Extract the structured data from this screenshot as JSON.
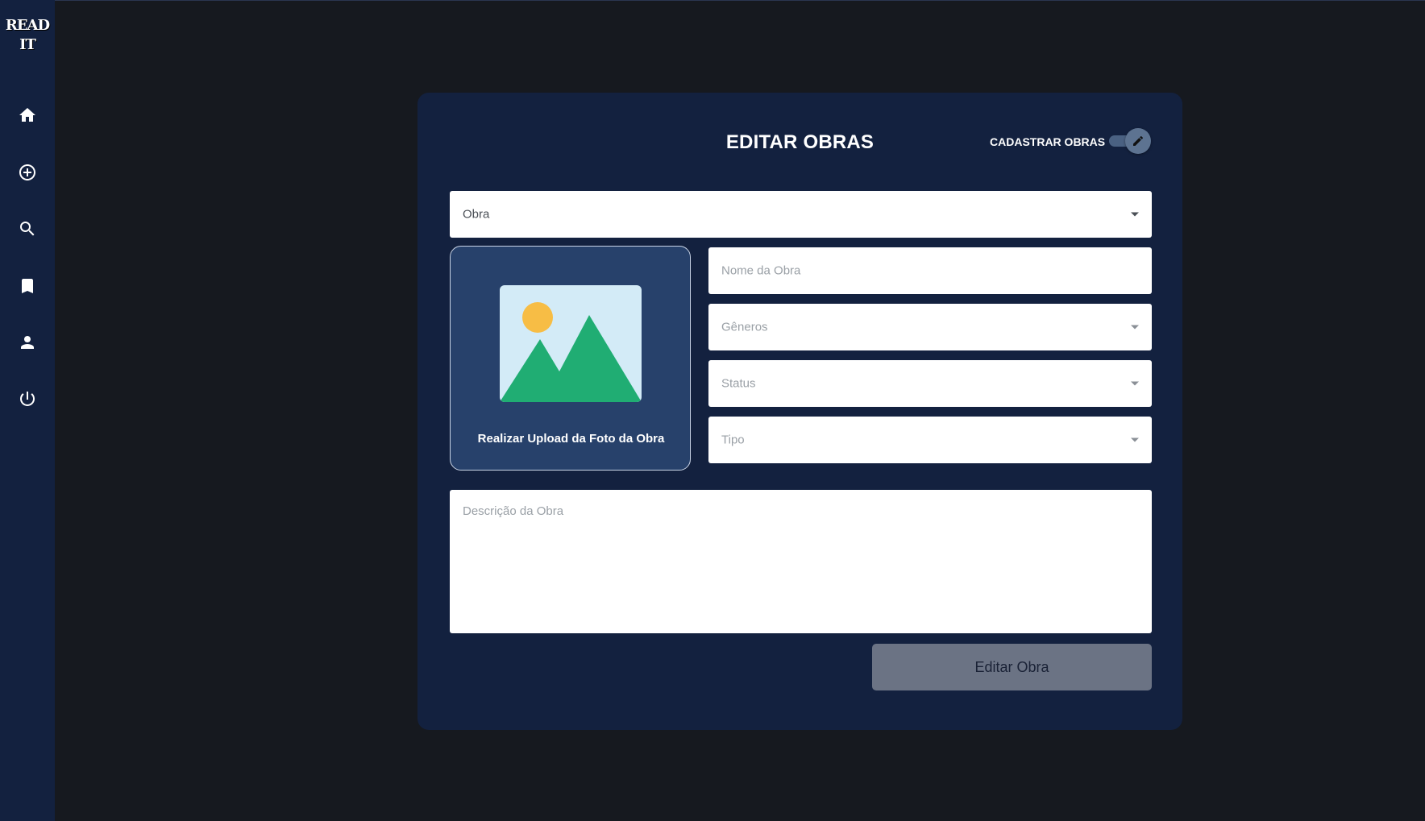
{
  "app": {
    "logo_text": "READ IT"
  },
  "sidebar": {
    "items": [
      {
        "icon": "home-icon"
      },
      {
        "icon": "add-circle-icon"
      },
      {
        "icon": "search-icon"
      },
      {
        "icon": "bookmark-icon"
      },
      {
        "icon": "user-icon"
      },
      {
        "icon": "power-icon"
      }
    ]
  },
  "form": {
    "title": "EDITAR OBRAS",
    "mode_switch": {
      "label": "CADASTRAR OBRAS",
      "icon": "pencil-icon",
      "checked": true
    },
    "obra_select": {
      "value": "Obra"
    },
    "upload": {
      "label": "Realizar Upload da Foto da Obra",
      "icon": "image-placeholder-icon"
    },
    "nome": {
      "placeholder": "Nome da Obra"
    },
    "generos": {
      "placeholder": "Gêneros"
    },
    "status": {
      "placeholder": "Status"
    },
    "tipo": {
      "placeholder": "Tipo"
    },
    "descricao": {
      "placeholder": "Descrição da Obra"
    },
    "submit_label": "Editar Obra"
  },
  "colors": {
    "page_bg": "#16191f",
    "sidebar_bg": "#13213f",
    "card_bg": "#13213f",
    "upload_bg": "#27416b",
    "button_bg": "#6b7384",
    "mountain_green": "#20ad73",
    "sun_yellow": "#f7bd45",
    "sky": "#d3ebf7"
  }
}
